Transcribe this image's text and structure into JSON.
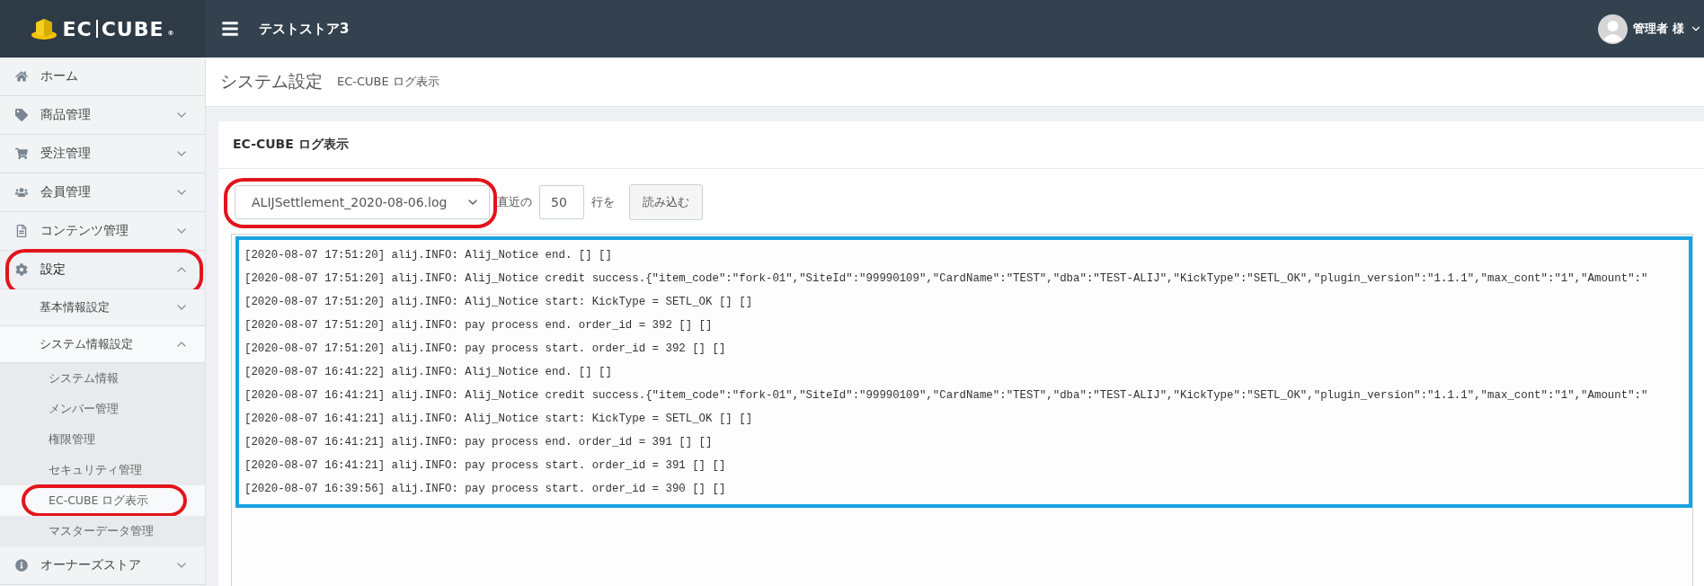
{
  "header": {
    "logo": {
      "left": "EC",
      "right": "CUBE",
      "mark": "®"
    },
    "store_name": "テストストア3",
    "user": "管理者 様"
  },
  "sidebar": {
    "items": [
      {
        "kind": "home",
        "label": "ホーム",
        "circled": false
      },
      {
        "kind": "tag",
        "label": "商品管理",
        "expanded": false,
        "circled": false
      },
      {
        "kind": "cart",
        "label": "受注管理",
        "expanded": false,
        "circled": false
      },
      {
        "kind": "users",
        "label": "会員管理",
        "expanded": false,
        "circled": false
      },
      {
        "kind": "file",
        "label": "コンテンツ管理",
        "expanded": false,
        "circled": false
      },
      {
        "kind": "gear",
        "label": "設定",
        "expanded": true,
        "circled": true,
        "children": [
          {
            "label": "基本情報設定",
            "expanded": false
          },
          {
            "label": "システム情報設定",
            "expanded": true,
            "children": [
              {
                "label": "システム情報",
                "selected": false,
                "circled": false
              },
              {
                "label": "メンバー管理",
                "selected": false,
                "circled": false
              },
              {
                "label": "権限管理",
                "selected": false,
                "circled": false
              },
              {
                "label": "セキュリティ管理",
                "selected": false,
                "circled": false
              },
              {
                "label": "EC-CUBE ログ表示",
                "selected": true,
                "circled": true
              },
              {
                "label": "マスターデータ管理",
                "selected": false,
                "circled": false
              }
            ]
          }
        ]
      },
      {
        "kind": "info",
        "label": "オーナーズストア",
        "expanded": false,
        "circled": false
      }
    ]
  },
  "page_title": {
    "main": "システム設定",
    "sub": "EC-CUBE ログ表示"
  },
  "card": {
    "title": "EC-CUBE ログ表示",
    "controls": {
      "file_select": {
        "value": "ALIJSettlement_2020-08-06.log",
        "circled": true
      },
      "prefix": "直近の",
      "line_count": "50",
      "suffix": "行を",
      "button": "読み込む"
    },
    "log": {
      "framed": true,
      "lines": [
        "[2020-08-07 17:51:20] alij.INFO: Alij_Notice end. [] []",
        "[2020-08-07 17:51:20] alij.INFO: Alij_Notice credit success.{\"item_code\":\"fork-01\",\"SiteId\":\"99990109\",\"CardName\":\"TEST\",\"dba\":\"TEST-ALIJ\",\"KickType\":\"SETL_OK\",\"plugin_version\":\"1.1.1\",\"max_cont\":\"1\",\"Amount\":\"",
        "[2020-08-07 17:51:20] alij.INFO: Alij_Notice start: KickType = SETL_OK [] []",
        "[2020-08-07 17:51:20] alij.INFO: pay process end. order_id = 392 [] []",
        "[2020-08-07 17:51:20] alij.INFO: pay process start. order_id = 392 [] []",
        "[2020-08-07 16:41:22] alij.INFO: Alij_Notice end. [] []",
        "[2020-08-07 16:41:21] alij.INFO: Alij_Notice credit success.{\"item_code\":\"fork-01\",\"SiteId\":\"99990109\",\"CardName\":\"TEST\",\"dba\":\"TEST-ALIJ\",\"KickType\":\"SETL_OK\",\"plugin_version\":\"1.1.1\",\"max_cont\":\"1\",\"Amount\":\"",
        "[2020-08-07 16:41:21] alij.INFO: Alij_Notice start: KickType = SETL_OK [] []",
        "[2020-08-07 16:41:21] alij.INFO: pay process end. order_id = 391 [] []",
        "[2020-08-07 16:41:21] alij.INFO: pay process start. order_id = 391 [] []",
        "[2020-08-07 16:39:56] alij.INFO: pay process start. order_id = 390 [] []"
      ]
    }
  }
}
